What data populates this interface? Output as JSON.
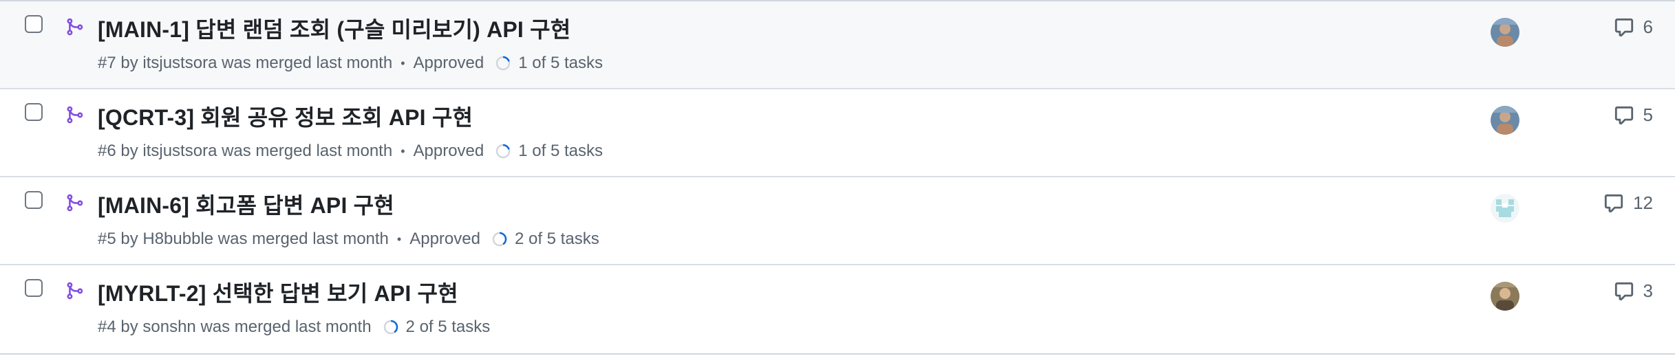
{
  "pull_requests": [
    {
      "title": "[MAIN-1] 답변 랜덤 조회 (구슬 미리보기) API 구현",
      "meta": "#7 by itsjustsora was merged last month",
      "review": "Approved",
      "tasks": "1 of 5 tasks",
      "task_done": 1,
      "task_total": 5,
      "comments": "6",
      "avatar": "photo-avatar"
    },
    {
      "title": "[QCRT-3] 회원 공유 정보 조회 API 구현",
      "meta": "#6 by itsjustsora was merged last month",
      "review": "Approved",
      "tasks": "1 of 5 tasks",
      "task_done": 1,
      "task_total": 5,
      "comments": "5",
      "avatar": "photo-avatar"
    },
    {
      "title": "[MAIN-6] 회고폼 답변 API 구현",
      "meta": "#5 by H8bubble was merged last month",
      "review": "Approved",
      "tasks": "2 of 5 tasks",
      "task_done": 2,
      "task_total": 5,
      "comments": "12",
      "avatar": "identicon-avatar"
    },
    {
      "title": "[MYRLT-2] 선택한 답변 보기 API 구현",
      "meta": "#4 by sonshn was merged last month",
      "review": "",
      "tasks": "2 of 5 tasks",
      "task_done": 2,
      "task_total": 5,
      "comments": "3",
      "avatar": "photo-avatar"
    }
  ],
  "colors": {
    "merged": "#8250df",
    "progress": "#0969da",
    "muted": "#59636e",
    "row_hover": "#f6f8fa"
  },
  "icons": {
    "merged": "git-merge-icon",
    "comment": "comment-icon",
    "progress": "task-progress-icon"
  }
}
